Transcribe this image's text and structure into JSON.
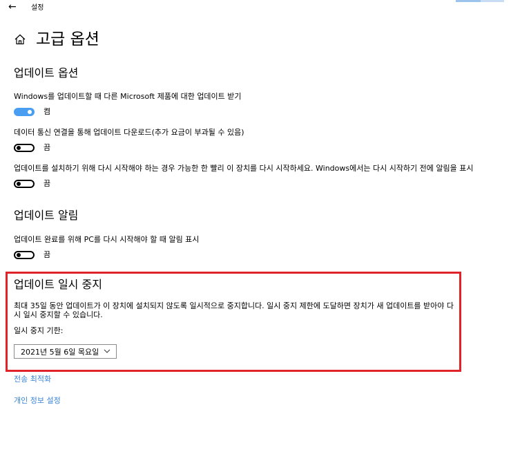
{
  "window": {
    "app_title": "설정"
  },
  "header": {
    "title": "고급 옵션"
  },
  "sections": {
    "update_options": {
      "heading": "업데이트 옵션",
      "items": [
        {
          "label": "Windows를 업데이트할 때 다른 Microsoft 제품에 대한 업데이트 받기",
          "state": "켬",
          "on": true
        },
        {
          "label": "데이터 통신 연결을 통해 업데이트 다운로드(추가 요금이 부과될 수 있음)",
          "state": "끔",
          "on": false
        },
        {
          "label": "업데이트를 설치하기 위해 다시 시작해야 하는 경우 가능한 한 빨리 이 장치를 다시 시작하세요. Windows에서는 다시 시작하기 전에 알림을 표시",
          "state": "끔",
          "on": false
        }
      ]
    },
    "update_notifications": {
      "heading": "업데이트 알림",
      "items": [
        {
          "label": "업데이트 완료를 위해 PC를 다시 시작해야 할 때 알림 표시",
          "state": "끔",
          "on": false
        }
      ]
    },
    "pause_updates": {
      "heading": "업데이트 일시 중지",
      "description": "최대 35일 동안 업데이트가 이 장치에 설치되지 않도록 일시적으로 중지합니다. 일시 중지 제한에 도달하면 장치가 새 업데이트를 받아야 다시 일시 중지할 수 있습니다.",
      "pause_until_label": "일시 중지 기한:",
      "pause_until_value": "2021년 5월 6일 목요일"
    }
  },
  "links": {
    "delivery_optimization": "전송 최적화",
    "privacy_settings": "개인 정보 설정"
  },
  "colors": {
    "toggle_on": "#4a9ef2",
    "link": "#3a84d6",
    "highlight_border": "#e02229"
  }
}
